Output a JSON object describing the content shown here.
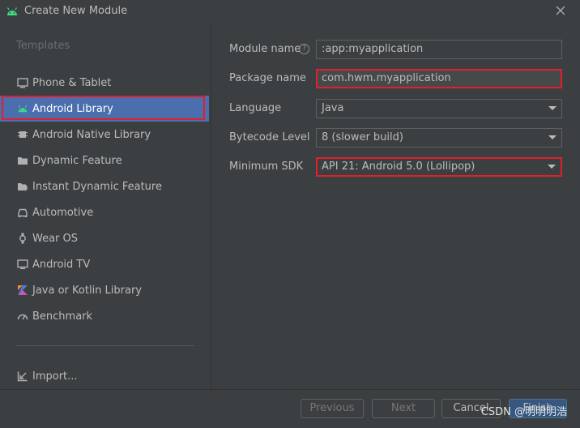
{
  "window": {
    "title": "Create New Module",
    "close_icon": "close-icon"
  },
  "sidebar": {
    "section_label": "Templates",
    "items": [
      {
        "label": "Phone & Tablet",
        "icon": "phone-tablet-icon"
      },
      {
        "label": "Android Library",
        "icon": "android-icon",
        "selected": true
      },
      {
        "label": "Android Native Library",
        "icon": "native-library-icon"
      },
      {
        "label": "Dynamic Feature",
        "icon": "dynamic-feature-icon"
      },
      {
        "label": "Instant Dynamic Feature",
        "icon": "instant-dynamic-feature-icon"
      },
      {
        "label": "Automotive",
        "icon": "car-icon"
      },
      {
        "label": "Wear OS",
        "icon": "watch-icon"
      },
      {
        "label": "Android TV",
        "icon": "tv-icon"
      },
      {
        "label": "Java or Kotlin Library",
        "icon": "kotlin-icon"
      },
      {
        "label": "Benchmark",
        "icon": "gauge-icon"
      }
    ],
    "import_label": "Import..."
  },
  "form": {
    "module_name": {
      "label": "Module name",
      "value": ":app:myapplication"
    },
    "package_name": {
      "label": "Package name",
      "value": "com.hwm.myapplication"
    },
    "language": {
      "label": "Language",
      "value": "Java"
    },
    "bytecode_level": {
      "label": "Bytecode Level",
      "value": "8 (slower build)"
    },
    "minimum_sdk": {
      "label": "Minimum SDK",
      "value": "API 21: Android 5.0 (Lollipop)"
    }
  },
  "footer": {
    "previous_label": "Previous",
    "next_label": "Next",
    "cancel_label": "Cancel",
    "finish_label": "Finish",
    "watermark": "CSDN @明明明浩"
  },
  "colors": {
    "selection": "#4b6eaf",
    "highlight_border": "#e0202a",
    "android_green": "#3ddc84",
    "background": "#3c3f41"
  }
}
